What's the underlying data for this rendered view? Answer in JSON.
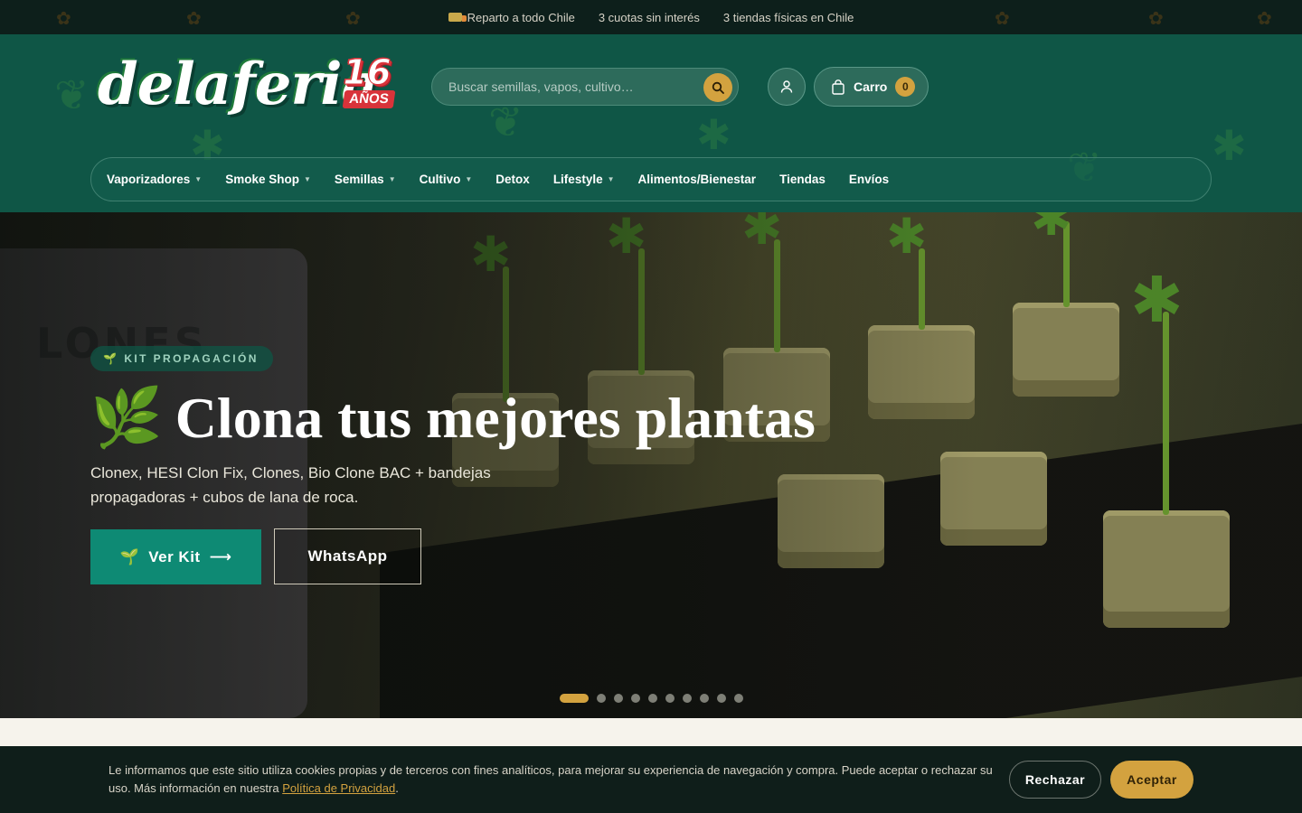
{
  "topbar": {
    "messages": [
      {
        "icon": "truck-icon",
        "text": "Reparto a todo Chile"
      },
      {
        "text": "3 cuotas sin interés"
      },
      {
        "text": "3 tiendas físicas en Chile"
      }
    ]
  },
  "header": {
    "logo": {
      "word": "delaferia",
      "badge_number": "16",
      "badge_text": "AÑOS"
    },
    "search": {
      "placeholder": "Buscar semillas, vapos, cultivo…",
      "icon": "search-icon"
    },
    "account": {
      "icon": "user-icon"
    },
    "cart": {
      "icon": "shopping-bag-icon",
      "label": "Carro",
      "count": "0"
    }
  },
  "nav": {
    "items": [
      {
        "label": "Vaporizadores",
        "has_dropdown": true
      },
      {
        "label": "Smoke Shop",
        "has_dropdown": true
      },
      {
        "label": "Semillas",
        "has_dropdown": true
      },
      {
        "label": "Cultivo",
        "has_dropdown": true
      },
      {
        "label": "Detox",
        "has_dropdown": false
      },
      {
        "label": "Lifestyle",
        "has_dropdown": true
      },
      {
        "label": "Alimentos/Bienestar",
        "has_dropdown": false
      },
      {
        "label": "Tiendas",
        "has_dropdown": false
      },
      {
        "label": "Envíos",
        "has_dropdown": false
      }
    ]
  },
  "hero": {
    "tag": "KIT PROPAGACIÓN",
    "tag_icon": "seedling-icon",
    "title_icon": "herb-icon",
    "title": "Clona tus mejores plantas",
    "subtitle": "Clonex, HESI Clon Fix, Clones, Bio Clone BAC + bandejas propagadoras + cubos de lana de roca.",
    "primary_button": {
      "label": "Ver Kit",
      "icon": "seedling-icon",
      "arrow": "arrow-right-icon"
    },
    "secondary_button": {
      "label": "WhatsApp"
    },
    "slides": {
      "total": 10,
      "active": 1
    }
  },
  "cookie_bar": {
    "text": "Le informamos que este sitio utiliza cookies propias y de terceros con fines analíticos, para mejorar su experiencia de navegación y compra. Puede aceptar o rechazar su uso. Más información en nuestra ",
    "link_label": "Política de Privacidad",
    "text_end": ".",
    "reject_label": "Rechazar",
    "accept_label": "Aceptar"
  },
  "colors": {
    "topbar_bg": "#0d1f1b",
    "header_bg": "#0f5646",
    "accent_gold": "#d3a23f",
    "primary_green": "#0e8a74",
    "logo_red": "#d8333a"
  }
}
